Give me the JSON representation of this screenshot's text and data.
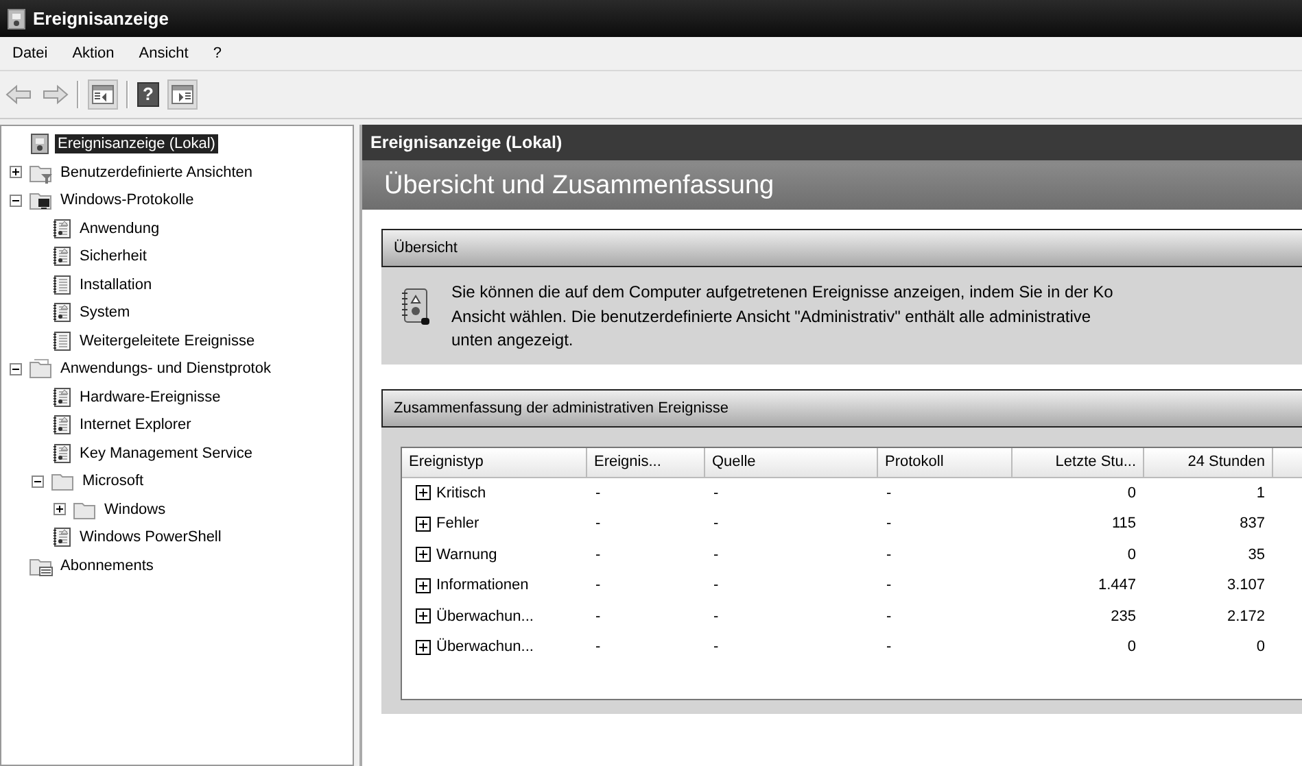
{
  "window": {
    "title": "Ereignisanzeige"
  },
  "menu": [
    "Datei",
    "Aktion",
    "Ansicht",
    "?"
  ],
  "toolbar": [
    {
      "kind": "back",
      "disabled": true
    },
    {
      "kind": "forward",
      "disabled": true
    },
    {
      "kind": "separator"
    },
    {
      "kind": "tree_pane",
      "pressed": true
    },
    {
      "kind": "separator"
    },
    {
      "kind": "help",
      "label": "?"
    },
    {
      "kind": "action_pane",
      "pressed": true
    }
  ],
  "tree": [
    {
      "label": "Ereignisanzeige (Lokal)",
      "kind": "root",
      "selected": true
    },
    {
      "label": "Benutzerdefinierte Ansichten",
      "kind": "filter_folder",
      "selected": false,
      "expanded": false
    },
    {
      "label": "Windows-Protokolle",
      "kind": "computer_folder",
      "selected": false,
      "expanded": true,
      "children": [
        {
          "label": "Anwendung",
          "kind": "log",
          "selected": false
        },
        {
          "label": "Sicherheit",
          "kind": "log",
          "selected": false
        },
        {
          "label": "Installation",
          "kind": "log_plain",
          "selected": false
        },
        {
          "label": "System",
          "kind": "log",
          "selected": false
        },
        {
          "label": "Weitergeleitete Ereignisse",
          "kind": "log_plain",
          "selected": false
        }
      ]
    },
    {
      "label": "Anwendungs- und Dienstprotok",
      "kind": "folder_stack",
      "selected": false,
      "expanded": true,
      "children": [
        {
          "label": "Hardware-Ereignisse",
          "kind": "log",
          "selected": false
        },
        {
          "label": "Internet Explorer",
          "kind": "log",
          "selected": false
        },
        {
          "label": "Key Management Service",
          "kind": "log",
          "selected": false
        },
        {
          "label": "Microsoft",
          "kind": "folder",
          "selected": false,
          "expanded": true,
          "children": [
            {
              "label": "Windows",
              "kind": "folder",
              "selected": false,
              "expanded": false
            }
          ]
        },
        {
          "label": "Windows PowerShell",
          "kind": "log",
          "selected": false
        }
      ]
    },
    {
      "label": "Abonnements",
      "kind": "subscriptions",
      "selected": false
    }
  ],
  "content": {
    "header": "Ereignisanzeige (Lokal)",
    "title": "Übersicht und Zusammenfassung",
    "overview": {
      "heading": "Übersicht",
      "text": "Sie können die auf dem Computer aufgetretenen Ereignisse anzeigen, indem Sie in der Ko\nAnsicht wählen. Die benutzerdefinierte Ansicht \"Administrativ\" enthält alle administrative\nunten angezeigt."
    },
    "summary": {
      "heading": "Zusammenfassung der administrativen Ereignisse",
      "table": {
        "columns": [
          "Ereignistyp",
          "Ereignis...",
          "Quelle",
          "Protokoll",
          "Letzte Stu...",
          "24 Stunden"
        ],
        "rows": [
          {
            "expanded": false,
            "cells": [
              "Kritisch",
              "-",
              "-",
              "-",
              "0",
              "1"
            ]
          },
          {
            "expanded": false,
            "cells": [
              "Fehler",
              "-",
              "-",
              "-",
              "115",
              "837"
            ]
          },
          {
            "expanded": false,
            "cells": [
              "Warnung",
              "-",
              "-",
              "-",
              "0",
              "35"
            ]
          },
          {
            "expanded": false,
            "cells": [
              "Informationen",
              "-",
              "-",
              "-",
              "1.447",
              "3.107"
            ]
          },
          {
            "expanded": false,
            "cells": [
              "Überwachun...",
              "-",
              "-",
              "-",
              "235",
              "2.172"
            ]
          },
          {
            "expanded": false,
            "cells": [
              "Überwachun...",
              "-",
              "-",
              "-",
              "0",
              "0"
            ]
          }
        ]
      }
    }
  }
}
